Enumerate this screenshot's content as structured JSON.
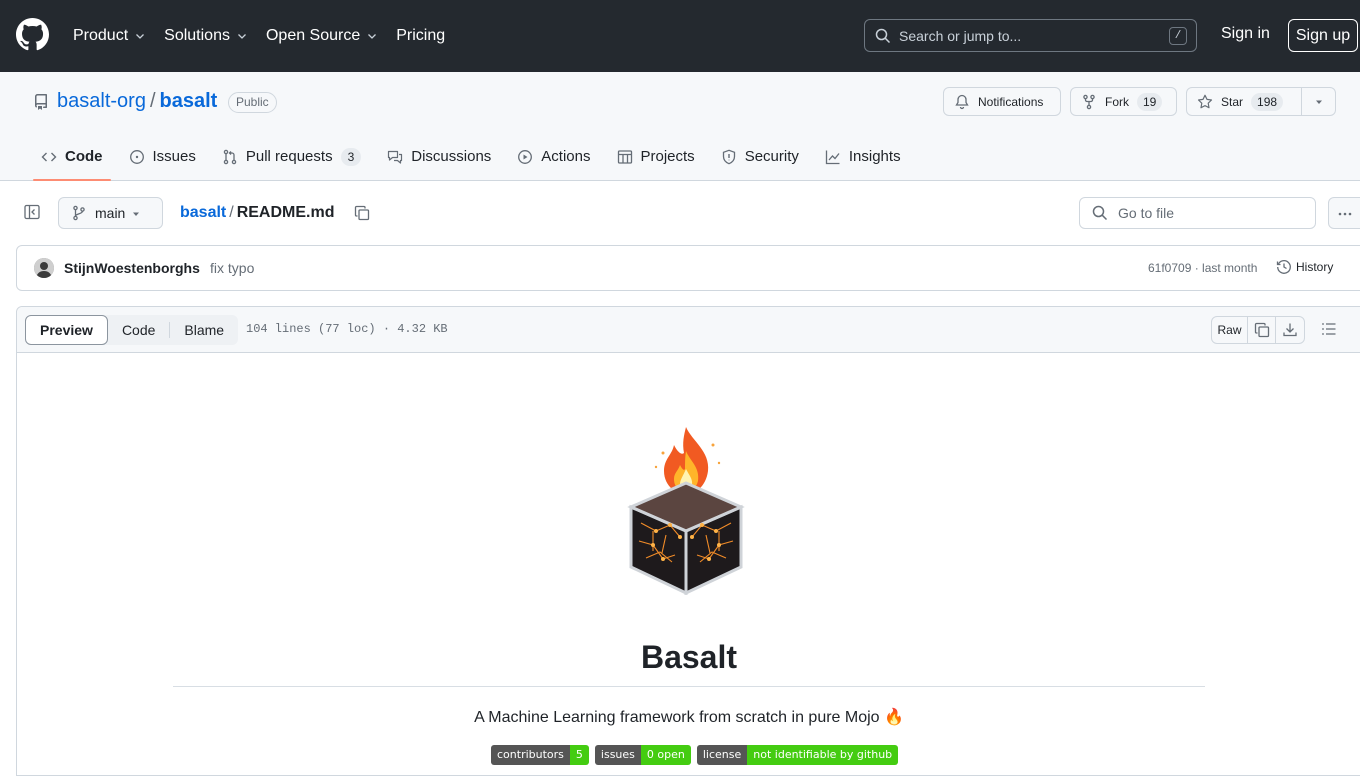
{
  "header": {
    "nav": [
      "Product",
      "Solutions",
      "Open Source",
      "Pricing"
    ],
    "search_placeholder": "Search or jump to...",
    "search_shortcut": "/",
    "signin": "Sign in",
    "signup": "Sign up"
  },
  "repo": {
    "owner": "basalt-org",
    "sep": "/",
    "name": "basalt",
    "visibility": "Public",
    "notifications": "Notifications",
    "fork_label": "Fork",
    "fork_count": "19",
    "star_label": "Star",
    "star_count": "198"
  },
  "tabs": [
    {
      "label": "Code"
    },
    {
      "label": "Issues"
    },
    {
      "label": "Pull requests",
      "count": "3"
    },
    {
      "label": "Discussions"
    },
    {
      "label": "Actions"
    },
    {
      "label": "Projects"
    },
    {
      "label": "Security"
    },
    {
      "label": "Insights"
    }
  ],
  "file": {
    "branch": "main",
    "crumb_repo": "basalt",
    "crumb_sep": "/",
    "crumb_file": "README.md",
    "goto_placeholder": "Go to file"
  },
  "commit": {
    "author": "StijnWoestenborghs",
    "message": "fix typo",
    "sha_time": "61f0709 · last month",
    "history": "History"
  },
  "viewer": {
    "modes": [
      "Preview",
      "Code",
      "Blame"
    ],
    "meta": "104 lines (77 loc) · 4.32 KB",
    "raw": "Raw"
  },
  "readme": {
    "title": "Basalt",
    "tagline": "A Machine Learning framework from scratch in pure Mojo 🔥",
    "badges": [
      {
        "label": "contributors",
        "value": "5"
      },
      {
        "label": "issues",
        "value": "0 open"
      },
      {
        "label": "license",
        "value": "not identifiable by github"
      }
    ]
  },
  "colors": {
    "accent": "#0969da",
    "header_bg": "#24292f",
    "tab_underline": "#fd8c73",
    "badge_green": "#44cc11"
  }
}
